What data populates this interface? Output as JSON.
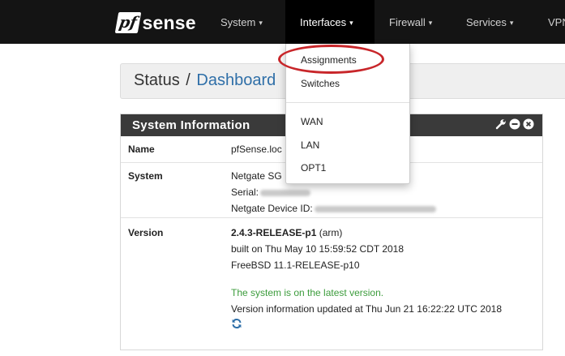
{
  "navbar": {
    "logo_pf": "pf",
    "logo_sense": "sense",
    "items": [
      {
        "label": "System",
        "caret": "▾"
      },
      {
        "label": "Interfaces",
        "caret": "▾"
      },
      {
        "label": "Firewall",
        "caret": "▾"
      },
      {
        "label": "Services",
        "caret": "▾"
      },
      {
        "label": "VPN"
      }
    ]
  },
  "dropdown": {
    "items": [
      "Assignments",
      "Switches",
      "WAN",
      "LAN",
      "OPT1"
    ]
  },
  "breadcrumb": {
    "section": "Status",
    "separator": "/",
    "page": "Dashboard"
  },
  "panel": {
    "title": "System Information",
    "tool_icons": [
      "wrench-icon",
      "minus-circle-icon",
      "close-circle-icon"
    ]
  },
  "info": {
    "name_label": "Name",
    "name_value": "pfSense.loc",
    "system_label": "System",
    "system_line1": "Netgate SG",
    "serial_label": "Serial:",
    "device_id_label": "Netgate Device ID:",
    "version_label": "Version",
    "version_bold": "2.4.3-RELEASE-p1",
    "version_arch": "(arm)",
    "built_on": "built on Thu May 10 15:59:52 CDT 2018",
    "freebsd": "FreeBSD 11.1-RELEASE-p10",
    "latest_status": "The system is on the latest version.",
    "updated_info": "Version information updated at Thu Jun 21 16:22:22 UTC 2018"
  },
  "colors": {
    "navbar_bg": "#141414",
    "panel_heading_bg": "#3a3a3a",
    "link_blue": "#2f6fa8",
    "status_green": "#3c9c3c",
    "annotation_red": "#c8262a"
  }
}
